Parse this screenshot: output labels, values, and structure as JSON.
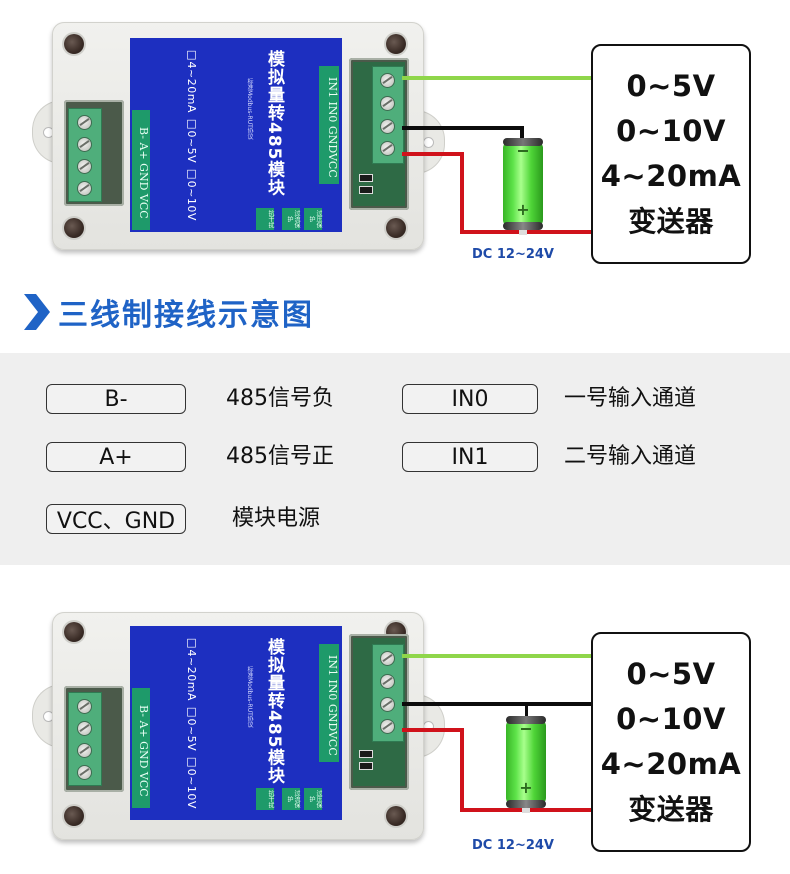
{
  "diagrams": [
    {
      "id": "top",
      "module": {
        "title": "模拟量转485模块",
        "subtitle": "标准Modbus-RUT协议",
        "ranges": "□4~20mA □0~5V □0~10V",
        "left_terminal_label": "B- A+ GND VCC",
        "right_terminal_label": "IN1 IN0 GNDVCC",
        "badges": [
          "抗干扰",
          "过流保护",
          "过压保护"
        ]
      },
      "wiring": {
        "green": "IN1 → transmitter signal",
        "black": "GND → battery negative",
        "red": "VCC → transmitter / battery positive"
      },
      "power_label": "DC 12~24V",
      "transmitter": {
        "lines": [
          "0~5V",
          "0~10V",
          "4~20mA",
          "变送器"
        ]
      }
    },
    {
      "id": "bottom",
      "module": {
        "title": "模拟量转485模块",
        "subtitle": "标准Modbus-RUT协议",
        "ranges": "□4~20mA □0~5V □0~10V",
        "left_terminal_label": "B- A+ GND VCC",
        "right_terminal_label": "IN1 IN0 GNDVCC",
        "badges": [
          "抗干扰",
          "过流保护",
          "过压保护"
        ]
      },
      "wiring": {
        "green": "IN1 → transmitter signal",
        "black": "GND → transmitter and battery negative",
        "red": "VCC → transmitter / battery positive"
      },
      "power_label": "DC 12~24V",
      "transmitter": {
        "lines": [
          "0~5V",
          "0~10V",
          "4~20mA",
          "变送器"
        ]
      }
    }
  ],
  "colors": {
    "heading_blue": "#1f63c6",
    "label_plate_blue": "#1d2fc0",
    "terminal_green": "#4fae7b",
    "wire_green": "#8fd64a",
    "wire_black": "#0c0c0c",
    "wire_red": "#d0121b",
    "power_label_blue": "#1e4aa8"
  },
  "section": {
    "icon": "chevron-right-icon",
    "title": "三线制接线示意图"
  },
  "legend": {
    "left": [
      {
        "pin": "B-",
        "desc": "485信号负"
      },
      {
        "pin": "A+",
        "desc": "485信号正"
      },
      {
        "pin": "VCC、GND",
        "desc": "模块电源"
      }
    ],
    "right": [
      {
        "pin": "IN0",
        "desc": "一号输入通道"
      },
      {
        "pin": "IN1",
        "desc": "二号输入通道"
      }
    ]
  }
}
